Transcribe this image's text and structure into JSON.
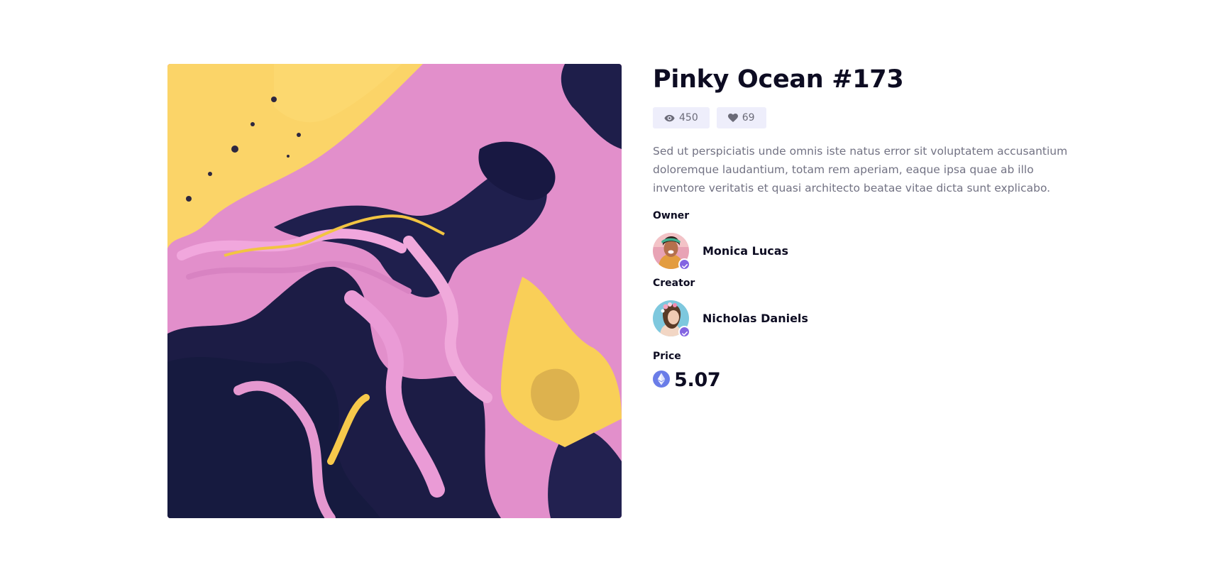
{
  "item": {
    "title": "Pinky Ocean #173",
    "views": "450",
    "likes": "69",
    "description": "Sed ut perspiciatis unde omnis iste natus error sit voluptatem accusantium doloremque laudantium, totam rem aperiam, eaque ipsa quae ab illo inventore veritatis et quasi architecto beatae vitae dicta sunt explicabo.",
    "owner_label": "Owner",
    "owner_name": "Monica Lucas",
    "creator_label": "Creator",
    "creator_name": "Nicholas Daniels",
    "price_label": "Price",
    "price_value": "5.07"
  },
  "icons": {
    "views": "eye-icon",
    "likes": "heart-icon",
    "verified": "check-icon",
    "currency": "ethereum-icon"
  },
  "colors": {
    "accent": "#8364e2",
    "stat_bg": "#eeeefb",
    "ethereum": "#6a7de8",
    "text_dark": "#0d0c22",
    "text_muted": "#727283"
  }
}
